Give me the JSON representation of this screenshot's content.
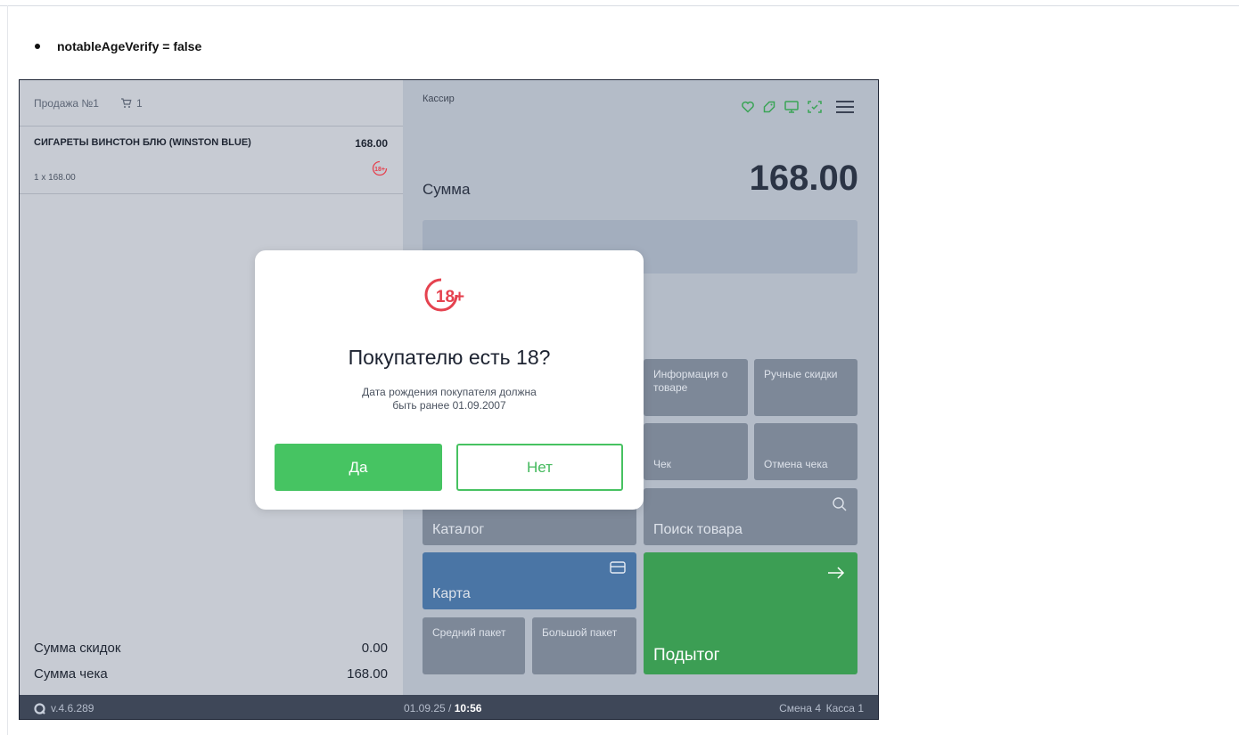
{
  "doc": {
    "bullet": "notableAgeVerify = false"
  },
  "sale": {
    "title": "Продажа №1",
    "cart_count": "1",
    "item": {
      "name": "СИГАРЕТЫ ВИНСТОН БЛЮ (WINSTON BLUE)",
      "price": "168.00",
      "qty": "1 x 168.00",
      "age_badge": "18+"
    },
    "discount_label": "Сумма скидок",
    "discount_value": "0.00",
    "total_label": "Сумма чека",
    "total_value": "168.00"
  },
  "register": {
    "role": "Кассир",
    "sum_label": "Сумма",
    "sum_value": "168.00",
    "icons": [
      "heart-icon",
      "tag-icon",
      "monitor-icon",
      "scan-icon",
      "menu-icon"
    ],
    "tiles": {
      "product_info": "Информация о товаре",
      "manual_discounts": "Ручные скидки",
      "receipt": "Чек",
      "cancel_receipt": "Отмена чека",
      "catalog": "Каталог",
      "search": "Поиск товара",
      "card": "Карта",
      "subtotal": "Подытог",
      "medium_bag": "Средний пакет",
      "large_bag": "Большой пакет"
    },
    "colors": {
      "card": "#4a75a5",
      "subtotal": "#3c9e54"
    }
  },
  "status": {
    "version": "v.4.6.289",
    "date": "01.09.25 / ",
    "time": "10:56",
    "shift": "Смена 4",
    "till": "Касса 1"
  },
  "dialog": {
    "badge": "18+",
    "title": "Покупателю есть 18?",
    "description_line1": "Дата рождения покупателя должна",
    "description_line2": "быть ранее 01.09.2007",
    "yes_label": "Да",
    "no_label": "Нет",
    "colors": {
      "yes": "#46c462",
      "badge": "#e5424f"
    }
  }
}
